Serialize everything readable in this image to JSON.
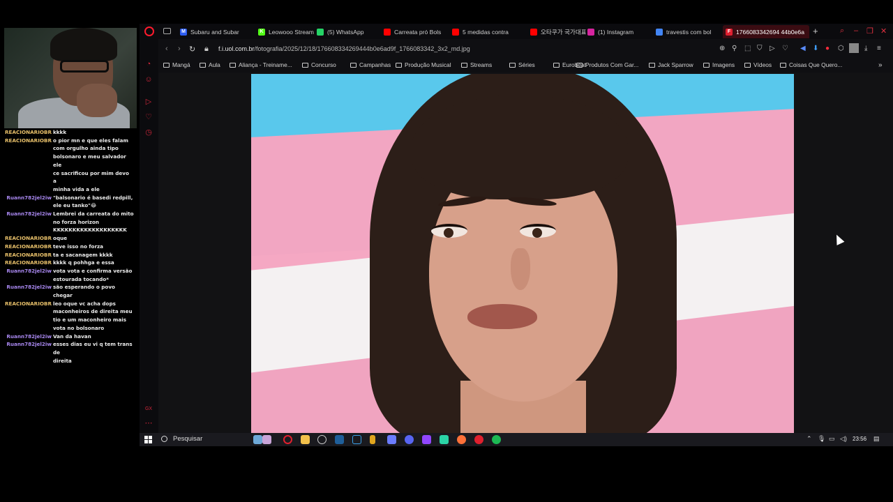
{
  "chat": [
    {
      "user": "REACIONARIOBR",
      "color": "#e8c06a",
      "msg": "kkkk"
    },
    {
      "user": "REACIONARIOBR",
      "color": "#e8c06a",
      "msg": "o pior mn e que eles falam\ncom orgulho ainda tipo\nbolsonaro e meu salvador ele\nce sacrificou por mim devo a\nminha vida a ele"
    },
    {
      "user": "Ruann782jel2iw",
      "color": "#a988f0",
      "msg": "\"balsonario é basedi redpill,\nele eu tanko\"😂"
    },
    {
      "user": "Ruann782jel2iw",
      "color": "#a988f0",
      "msg": "Lembrei da carreata do mito\nno forza horizon\nKKKKKKKKKKKKKKKKKKK"
    },
    {
      "user": "REACIONARIOBR",
      "color": "#e8c06a",
      "msg": "oque"
    },
    {
      "user": "REACIONARIOBR",
      "color": "#e8c06a",
      "msg": "teve isso no forza"
    },
    {
      "user": "REACIONARIOBR",
      "color": "#e8c06a",
      "msg": "ta e sacanagem kkkk"
    },
    {
      "user": "REACIONARIOBR",
      "color": "#e8c06a",
      "msg": "kkkk q pohhga e essa"
    },
    {
      "user": "Ruann782jel2iw",
      "color": "#a988f0",
      "msg": "vota vota e confirma versão\nestourada tocando*"
    },
    {
      "user": "Ruann782jel2iw",
      "color": "#a988f0",
      "msg": "são esperando o povo chegar"
    },
    {
      "user": "REACIONARIOBR",
      "color": "#e8c06a",
      "msg": "leo oque vc acha dops\nmaconheiros de direita meu\ntio e um maconheiro mais\nvota no bolsonaro"
    },
    {
      "user": "Ruann782jel2iw",
      "color": "#a988f0",
      "msg": "Van da havan"
    },
    {
      "user": "Ruann782jel2iw",
      "color": "#a988f0",
      "msg": "esses dias eu vi q tem trans de\ndireita"
    }
  ],
  "tabs": [
    {
      "label": "Subaru and Subar",
      "icon": "M",
      "color": "#2c5cf0"
    },
    {
      "label": "Leowooo Stream",
      "icon": "K",
      "color": "#53fc18"
    },
    {
      "label": "(5) WhatsApp",
      "icon": "whatsapp",
      "color": "#25d366"
    },
    {
      "label": "Carreata pró Bols",
      "icon": "youtube",
      "color": "#ff0000"
    },
    {
      "label": "5 medidas contra",
      "icon": "youtube",
      "color": "#ff0000"
    },
    {
      "label": "오타쿠가 국가대표",
      "icon": "youtube",
      "color": "#ff0000"
    },
    {
      "label": "(1) Instagram",
      "icon": "instagram",
      "color": "#d6249f"
    },
    {
      "label": "travestis com bol",
      "icon": "google",
      "color": "#4285f4"
    },
    {
      "label": "1766083342694 44b0e6a",
      "icon": "F",
      "color": "#e02030",
      "active": true
    }
  ],
  "url": {
    "host": "f.i.uol.com.br",
    "path": "/fotografia/2025/12/18/176608334269444b0e6ad9f_1766083342_3x2_md.jpg"
  },
  "bookmarks": [
    "Mangá",
    "Aula",
    "Aliança - Treiname...",
    "Concurso",
    "Campanhas",
    "Produção Musical",
    "Streams",
    "Séries",
    "Eurobeat",
    "Produtos Com Gar...",
    "Jack Sparrow",
    "Imagens",
    "Vídeos",
    "Coisas Que Quero..."
  ],
  "taskbar": {
    "search_placeholder": "Pesquisar",
    "time": "23:56"
  }
}
